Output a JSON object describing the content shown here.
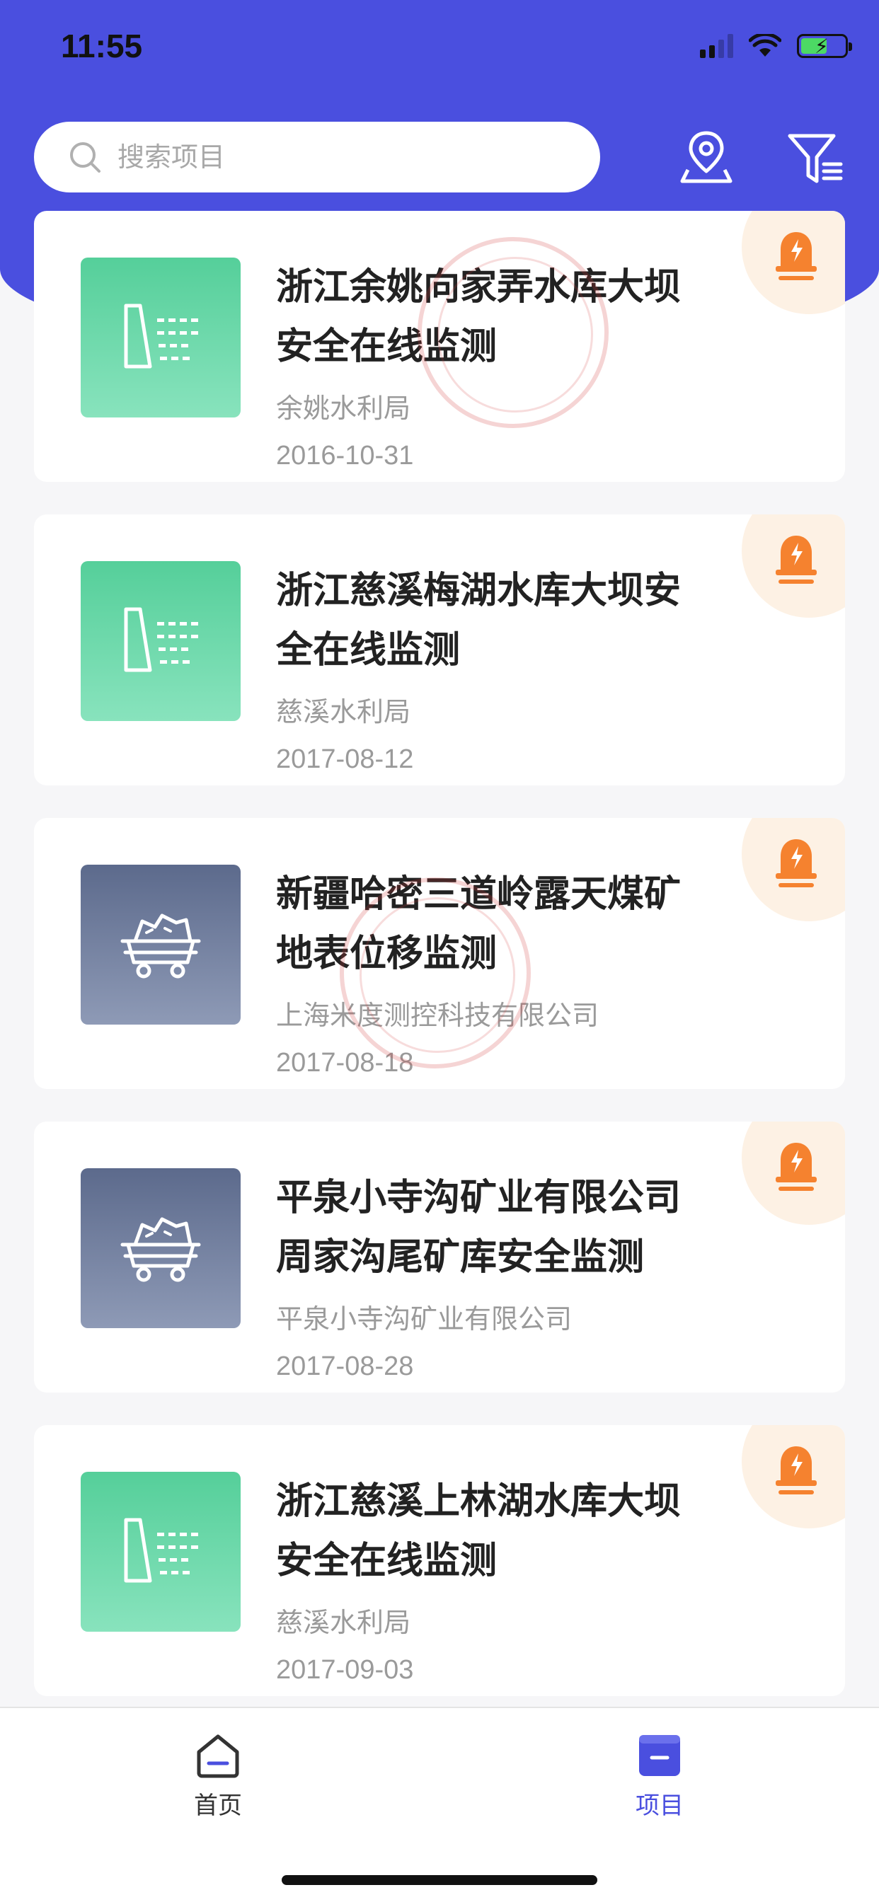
{
  "status_bar": {
    "time": "11:55"
  },
  "search": {
    "placeholder": "搜索项目"
  },
  "projects": [
    {
      "title": "浙江余姚向家弄水库大坝安全在线监测",
      "org": "余姚水利局",
      "date": "2016-10-31",
      "thumb_icon": "dam-icon",
      "thumb_color": "#55cf9a"
    },
    {
      "title": "浙江慈溪梅湖水库大坝安全在线监测",
      "org": "慈溪水利局",
      "date": "2017-08-12",
      "thumb_icon": "dam-icon",
      "thumb_color": "#55cf9a"
    },
    {
      "title": "新疆哈密三道岭露天煤矿地表位移监测",
      "org": "上海米度测控科技有限公司",
      "date": "2017-08-18",
      "thumb_icon": "mine-cart-icon",
      "thumb_color": "#5c6a8c"
    },
    {
      "title": "平泉小寺沟矿业有限公司周家沟尾矿库安全监测",
      "org": "平泉小寺沟矿业有限公司",
      "date": "2017-08-28",
      "thumb_icon": "mine-cart-icon",
      "thumb_color": "#5c6a8c"
    },
    {
      "title": "浙江慈溪上林湖水库大坝安全在线监测",
      "org": "慈溪水利局",
      "date": "2017-09-03",
      "thumb_icon": "dam-icon",
      "thumb_color": "#55cf9a"
    }
  ],
  "tabbar": {
    "home_label": "首页",
    "projects_label": "项目",
    "active": "projects"
  },
  "colors": {
    "brand": "#4a4fdf",
    "alarm": "#f5822f",
    "alarm_bg": "#fdf1e4"
  }
}
